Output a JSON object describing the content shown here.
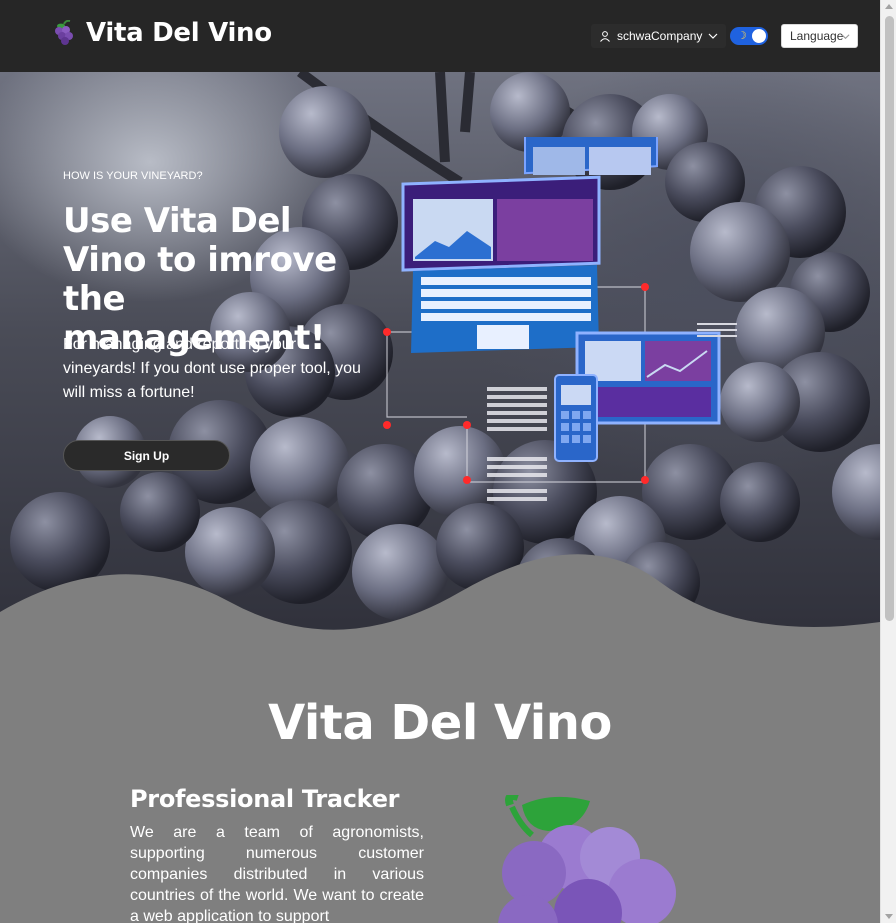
{
  "app": {
    "title": "Vita Del Vino",
    "logo_icon": "grape-icon"
  },
  "header": {
    "user_label": "schwaCompany",
    "user_icon": "user-icon",
    "theme_toggle": {
      "on": true,
      "icon": "moon-icon"
    },
    "language_label": "Language"
  },
  "hero": {
    "eyebrow": "HOW IS YOUR VINEYARD?",
    "title": "Use Vita Del Vino to imrove the management!",
    "subtitle": "For managing and reporting your vineyards! If you dont use proper tool, you will miss a fortune!",
    "signup_label": "Sign Up"
  },
  "about": {
    "title": "Vita Del Vino",
    "feature_title": "Professional Tracker",
    "feature_text": "We are a team of agronomists, supporting numerous customer companies distributed in various countries of the world. We want to create a web application to support"
  },
  "colors": {
    "header_bg": "#262626",
    "toggle_accent": "#1f62e0",
    "section_bg": "#7f7f7f",
    "grape_purple": "#9b7bd0",
    "leaf_green": "#2da33a"
  }
}
